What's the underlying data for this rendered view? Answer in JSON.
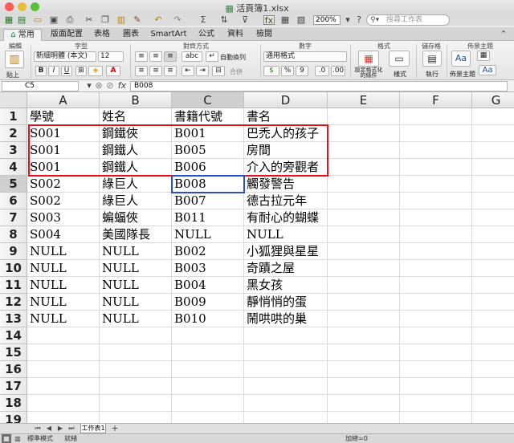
{
  "window": {
    "title": "活頁簿1.xlsx",
    "zoom": "200%",
    "search_placeholder": "搜尋工作表"
  },
  "tabs": [
    "常用",
    "版面配置",
    "表格",
    "圖表",
    "SmartArt",
    "公式",
    "資料",
    "檢閱"
  ],
  "ribbon": {
    "groups": {
      "edit": "編輯",
      "font": "字型",
      "align": "對齊方式",
      "number": "數字",
      "format": "格式",
      "cells": "儲存格",
      "theme": "佈景主題"
    },
    "font_name": "新細明體 (本文)",
    "font_size": "12",
    "paste_label": "貼上",
    "wrap_label": "自動換列",
    "merge_label": "合併",
    "number_format": "通用格式",
    "cond_format_label": "設定格式化的條件",
    "style_label": "樣式",
    "exec_label": "執行",
    "theme_label": "佈景主題",
    "bold": "B",
    "italic": "I",
    "underline": "U",
    "abc": "abc",
    "percent": "%",
    "comma": "9",
    "theme_aa": "Aa"
  },
  "formula_bar": {
    "name_box": "C5",
    "fx": "fx",
    "value": "B008"
  },
  "columns": [
    "A",
    "B",
    "C",
    "D",
    "E",
    "F",
    "G"
  ],
  "rows": [
    "1",
    "2",
    "3",
    "4",
    "5",
    "6",
    "7",
    "8",
    "9",
    "10",
    "11",
    "12",
    "13",
    "14",
    "15",
    "16",
    "17",
    "18",
    "19"
  ],
  "cells": [
    [
      "學號",
      "姓名",
      "書籍代號",
      "書名"
    ],
    [
      "S001",
      "鋼鐵俠",
      "B001",
      "巴禿人的孩子"
    ],
    [
      "S001",
      "鋼鐵人",
      "B005",
      "房間"
    ],
    [
      "S001",
      "鋼鐵人",
      "B006",
      "介入的旁觀者"
    ],
    [
      "S002",
      "綠巨人",
      "B008",
      "觸發警告"
    ],
    [
      "S002",
      "綠巨人",
      "B007",
      "德古拉元年"
    ],
    [
      "S003",
      "蝙蝠俠",
      "B011",
      "有耐心的蝴蝶"
    ],
    [
      "S004",
      "美國隊長",
      "NULL",
      "NULL"
    ],
    [
      "NULL",
      "NULL",
      "B002",
      "小狐狸與星星"
    ],
    [
      "NULL",
      "NULL",
      "B003",
      "奇蹟之屋"
    ],
    [
      "NULL",
      "NULL",
      "B004",
      "黑女孩"
    ],
    [
      "NULL",
      "NULL",
      "B009",
      "靜悄悄的蛋"
    ],
    [
      "NULL",
      "NULL",
      "B010",
      "鬧哄哄的巢"
    ]
  ],
  "sheet_tab": "工作表1",
  "status": {
    "mode": "標準模式",
    "ready": "就緒",
    "sum": "加總=0"
  },
  "colors": {
    "highlight_border": "#e0141e",
    "active_cell_border": "#2d4fc4",
    "ribbon_accent": "#1e7a3c"
  }
}
